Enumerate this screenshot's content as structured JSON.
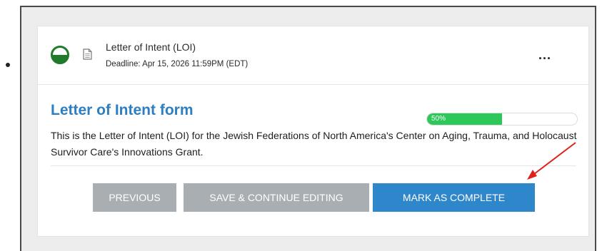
{
  "task": {
    "title": "Letter of Intent (LOI)",
    "deadline": "Deadline: Apr 15, 2026 11:59PM (EDT)",
    "more_label": "...",
    "status_icon": "half-complete-circle-icon",
    "doc_icon": "document-icon"
  },
  "form": {
    "title": "Letter of Intent form",
    "progress_label": "50%",
    "progress_percent": 50,
    "description": "This is the Letter of Intent (LOI) for the Jewish Federations of North America's Center on Aging, Trauma, and Holocaust Survivor Care's Innovations Grant."
  },
  "actions": {
    "previous": "PREVIOUS",
    "save": "SAVE & CONTINUE EDITING",
    "complete": "MARK AS COMPLETE"
  },
  "colors": {
    "status_green": "#1f7a2c",
    "progress_green": "#2ec85a",
    "title_blue": "#2d7fc1",
    "primary_button": "#2f87cb",
    "secondary_button": "#a9aeb2",
    "annotation_arrow": "#e0201b"
  }
}
